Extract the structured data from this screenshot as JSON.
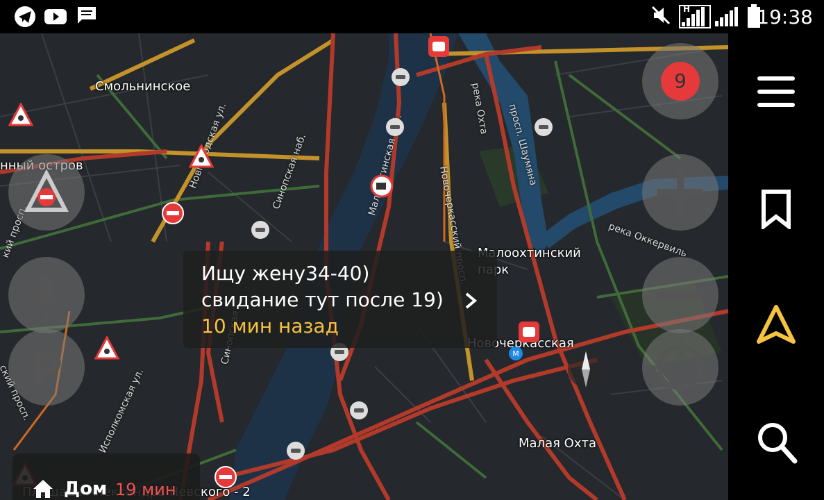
{
  "status_bar": {
    "time": "19:38",
    "network_label": "H",
    "icons": [
      "telegram-icon",
      "youtube-icon",
      "message-icon",
      "mute-icon",
      "signal-h-icon",
      "signal-2-icon",
      "battery-icon"
    ]
  },
  "map": {
    "labels": {
      "smolninskoe": "Смольнинское",
      "island": "нный остров",
      "malookhtinsky_park_1": "Малоохтинский",
      "malookhtinsky_park_2": "парк",
      "novocherkasskaya": "Новочеркасская",
      "malaya_okhta": "Малая Охта",
      "ploshchad": "Площадь Александра Невского - 2",
      "okhta_river": "река Охта",
      "okkervil_river": "река Оккервиль",
      "novgorodskaya": "Новгородская ул.",
      "sinopskaya_1": "Синопская наб.",
      "sinopskaya_2": "Синопская",
      "novocherkassky_prosp": "Новочеркасский просп.",
      "shaumyana": "просп. Шаумяна",
      "malookhtinskaya_nab": "Малоохтинская наб.",
      "ispolkomskaya": "Исполкомская ул.",
      "prosp_left": "кий просп.",
      "prosp_left2": "ский просп."
    },
    "traffic_score": "9",
    "accent_yellow": "#f5c242",
    "traffic_red": "#e63a3a"
  },
  "popup": {
    "line1": "Ищу жену34-40)",
    "line2": "свидание тут после 19)",
    "time_ago": "10 мин назад"
  },
  "route_card": {
    "destination": "Дом",
    "eta": "19 мин"
  },
  "side_panel": {
    "icons": [
      "menu-icon",
      "bookmark-icon",
      "navigation-arrow-icon",
      "search-icon"
    ]
  }
}
